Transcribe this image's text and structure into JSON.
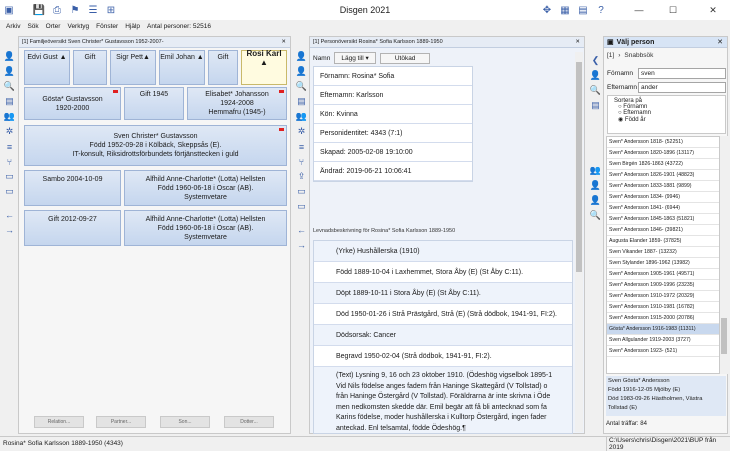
{
  "app": {
    "title": "Disgen 2021",
    "min": "—",
    "max": "☐",
    "close": "✕"
  },
  "menu": [
    "Arkiv",
    "Sök",
    "Orter",
    "Verktyg",
    "Fönster",
    "Hjälp",
    "Antal personer: 52516"
  ],
  "family": {
    "header": "[1] Familjeöversikt Sven Christer* Gustavsson 1952-2007-",
    "top": [
      "Edvi Gust ▲",
      "Gift",
      "Sigr Pett▲",
      "Emil Johan ▲",
      "Gift",
      "Rosi Karl ▲"
    ],
    "p_left": [
      "Gösta* Gustavsson",
      "1920-2000"
    ],
    "married1": "Gift 1945",
    "p_right": [
      "Elisabet* Johansson",
      "1924-2008",
      "Hemmafru (1945-)"
    ],
    "main": [
      "Sven Christer* Gustavsson",
      "Född 1952-09-28 i Kölbäck, Skeppsås (E).",
      "IT-konsult, Riksidrottsförbundets förtjänsttecken i guld"
    ],
    "sambo": "Sambo 2004-10-09",
    "sp1": [
      "Alfhild Anne-Charlotte* (Lotta) Hellsten",
      "Född 1960-06-18 i Oscar (AB).",
      "Systemvetare"
    ],
    "gift2": "Gift 2012-09-27",
    "sp2": [
      "Alfhild Anne-Charlotte* (Lotta) Hellsten",
      "Född 1960-06-18 i Oscar (AB).",
      "Systemvetare"
    ],
    "buttons": [
      "Relation...",
      "Partner...",
      "Son...",
      "Dotter..."
    ]
  },
  "person": {
    "header": "[1] Personöversikt Rosina* Sofia Karlsson 1889-1950",
    "tabs": {
      "namn": "Namn",
      "lagg": "Lägg till",
      "utokad": "Utökad"
    },
    "fields": [
      "Förnamn: Rosina* Sofia",
      "Efternamn: Karlsson",
      "Kön: Kvinna",
      "Personidentitet: 4343 (7:1)",
      "Skapad:  2005-02-08  19:10:00",
      "Ändrad:  2019-06-21  10:06:41"
    ],
    "bio_header": "Levnadsbeskrivning för Rosina* Sofia Karlsson 1889-1950",
    "bio": [
      "(Yrke) Hushållerska (1910)",
      "Född 1889-10-04 i Laxhemmet, Stora Åby (E) (St Åby C:11).",
      "Döpt 1889-10-11 i Stora Åby (E) (St Åby C:11).",
      "Död 1950-01-26 i Strå Prästgård, Strå (E) (Strå dödbok, 1941-91, FI:2).",
      "Dödsorsak: Cancer",
      "Begravd 1950-02-04 (Strå dödbok, 1941-91, FI:2)."
    ],
    "text": [
      "(Text) Lysning 9, 16 och 23 oktober 1910. (Ödeshög vigselbok 1895-1",
      "Vid Nils födelse anges fadern från Haninge Skattegård (V Tollstad) o",
      "från Haninge Östergård (V Tollstad). Föräldrarna är inte skrivna i Öde",
      "men nedkomsten skedde där. Emil begär att få bli antecknad som fa",
      "Karins födelse, moder hushållerska i Kulltorp Östergård, ingen fader",
      "anteckad. Enl telsamtal, födde Ödeshög.¶"
    ]
  },
  "picker": {
    "header": "Välj person",
    "tabs": {
      "num": "[1]",
      "quick": "Snabbsök"
    },
    "fornamn_label": "Förnamn",
    "fornamn": "sven",
    "efternamn_label": "Efternamn",
    "efternamn": "ander",
    "sort_label": "Sortera på",
    "sort": [
      "Förnamn",
      "Efternamn",
      "Född år"
    ],
    "list": [
      "Sven* Andersson 1818- (52251)",
      "Sven* Andersson 1820-1896 (13117)",
      "Sven Birgén 1826-1863 (43722)",
      "Sven* Andersson 1826-1901 (48823)",
      "Sven* Andersson 1833-1881 (9899)",
      "Sven* Andersson 1834- (9946)",
      "Sven* Andersson 1841- (6944)",
      "Sven* Andersson 1845-1863 (51821)",
      "Sven* Andersson 1846- (39821)",
      "Augusta Elander 1859- (37825)",
      "Sven Vikander 1887- (13232)",
      "Sven Stylander 1896-1962 (13982)",
      "Sven* Andersson 1905-1961 (49571)",
      "Sven* Andersson 1909-1996 (23235)",
      "Sven* Andersson 1910-1972 (20329)",
      "Sven* Andersson 1910-1981 (16782)",
      "Sven* Andersson 1915-2000 (20786)",
      "Gösta* Andersson 1916-1983 (11311)",
      "Sven Allgulander 1919-2003 (3727)",
      "Sven* Andersson 1923- (521)"
    ],
    "selected_index": 17,
    "info": [
      "Sven Gösta* Andersson",
      "Född 1916-12-05 Mjölby (E)",
      "Död 1983-09-26 Hästholmen, Västra",
      "Tollstad (E)"
    ],
    "hits": "Antal träffar: 84"
  },
  "status": {
    "left": "Rosina* Sofia Karlsson 1889-1950 (4343)",
    "right": "C:\\Users\\chris\\Disgen\\2021\\BUP från 2019"
  }
}
